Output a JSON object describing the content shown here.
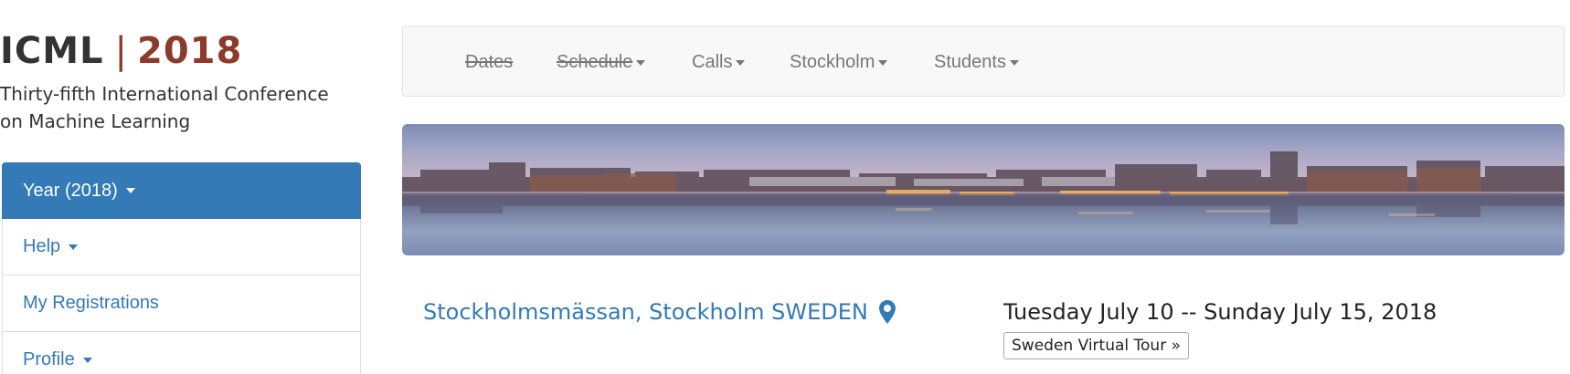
{
  "site": {
    "acronym": "ICML",
    "separator": "|",
    "year": "2018",
    "subtitle": "Thirty-fifth International Conference on Machine Learning"
  },
  "sidebar": {
    "items": [
      {
        "label": "Year (2018)",
        "active": true,
        "has_caret": true
      },
      {
        "label": "Help",
        "active": false,
        "has_caret": true
      },
      {
        "label": "My Registrations",
        "active": false,
        "has_caret": false
      },
      {
        "label": "Profile",
        "active": false,
        "has_caret": true
      }
    ]
  },
  "navbar": {
    "items": [
      {
        "label": "Dates",
        "struck": true,
        "has_caret": false
      },
      {
        "label": "Schedule",
        "struck": true,
        "has_caret": true
      },
      {
        "label": "Calls",
        "struck": false,
        "has_caret": true
      },
      {
        "label": "Stockholm",
        "struck": false,
        "has_caret": true
      },
      {
        "label": "Students",
        "struck": false,
        "has_caret": true
      }
    ]
  },
  "banner": {
    "icon": "stockholm-panorama-image"
  },
  "event": {
    "venue": "Stockholmsmässan, Stockholm SWEDEN",
    "venue_icon": "map-marker-icon",
    "dates": "Tuesday July 10 -- Sunday July 15, 2018",
    "tour_button": "Sweden Virtual Tour »"
  },
  "colors": {
    "brand_red": "#8c3b2a",
    "primary_blue": "#337ab7",
    "navbar_bg": "#f8f8f8",
    "nav_text": "#777777"
  }
}
